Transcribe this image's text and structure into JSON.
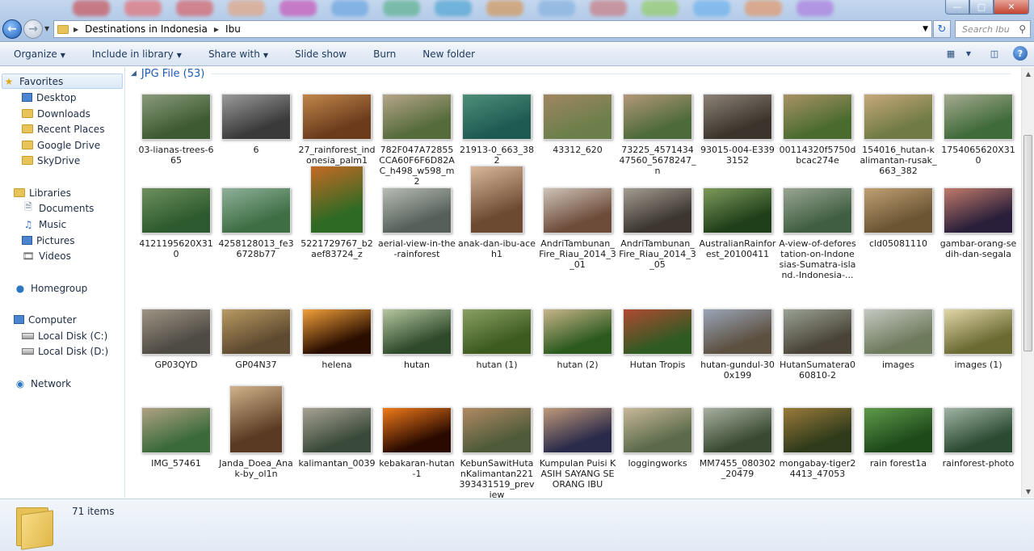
{
  "window": {
    "breadcrumb": [
      "Destinations in Indonesia",
      "Ibu"
    ],
    "search_placeholder": "Search Ibu",
    "controls": [
      "minimize",
      "maximize",
      "close"
    ]
  },
  "toolbar": {
    "organize": "Organize",
    "include_in_library": "Include in library",
    "share_with": "Share with",
    "slide_show": "Slide show",
    "burn": "Burn",
    "new_folder": "New folder"
  },
  "nav": {
    "favorites": {
      "label": "Favorites",
      "items": [
        "Desktop",
        "Downloads",
        "Recent Places",
        "Google Drive",
        "SkyDrive"
      ]
    },
    "libraries": {
      "label": "Libraries",
      "items": [
        "Documents",
        "Music",
        "Pictures",
        "Videos"
      ]
    },
    "homegroup": "Homegroup",
    "computer": {
      "label": "Computer",
      "items": [
        "Local Disk (C:)",
        "Local Disk (D:)"
      ]
    },
    "network": "Network"
  },
  "group": {
    "title": "JPG File (53)"
  },
  "files": [
    {
      "name": "03-lianas-trees-665",
      "shape": "land",
      "colors": [
        "#3d5a32",
        "#8a9a7a"
      ]
    },
    {
      "name": "6",
      "shape": "land",
      "colors": [
        "#3a3a3a",
        "#9a9a9a"
      ]
    },
    {
      "name": "27_rainforest_indonesia_palm1",
      "shape": "land",
      "colors": [
        "#6b3b1c",
        "#c0864a"
      ]
    },
    {
      "name": "782F047A72855CCA60F6F6D82AC_h498_w598_m2",
      "shape": "land",
      "colors": [
        "#556b3a",
        "#b5a58a"
      ]
    },
    {
      "name": "21913-0_663_382",
      "shape": "land",
      "colors": [
        "#1f5a52",
        "#4d8f7a"
      ]
    },
    {
      "name": "43312_620",
      "shape": "land",
      "colors": [
        "#6c7f4a",
        "#a08662"
      ]
    },
    {
      "name": "73225_457143447560_5678247_n",
      "shape": "land",
      "colors": [
        "#4d6a3a",
        "#b39878"
      ]
    },
    {
      "name": "93015-004-E3393152",
      "shape": "land",
      "colors": [
        "#3b342c",
        "#8c8277"
      ]
    },
    {
      "name": "00114320f5750dbcac274e",
      "shape": "land",
      "colors": [
        "#4a6b2e",
        "#a89266"
      ]
    },
    {
      "name": "154016_hutan-kalimantan-rusak_663_382",
      "shape": "land",
      "colors": [
        "#6f7a44",
        "#c6a87a"
      ]
    },
    {
      "name": "1754065620X310",
      "shape": "land",
      "colors": [
        "#3f6a3a",
        "#a5aa8f"
      ]
    },
    {
      "name": "4121195620X310",
      "shape": "land",
      "colors": [
        "#2d5a2e",
        "#6e8f5e"
      ]
    },
    {
      "name": "4258128013_fe36728b77",
      "shape": "land",
      "colors": [
        "#3e6f43",
        "#8fb09a"
      ]
    },
    {
      "name": "5221729767_b2aef83724_z",
      "shape": "port",
      "colors": [
        "#2f6a24",
        "#c46a24"
      ]
    },
    {
      "name": "aerial-view-in-the-rainforest",
      "shape": "land",
      "colors": [
        "#55605a",
        "#b8bcb5"
      ]
    },
    {
      "name": "anak-dan-ibu-aceh1",
      "shape": "port",
      "colors": [
        "#6c4a32",
        "#d8b79a"
      ]
    },
    {
      "name": "AndriTambunan_Fire_Riau_2014_3_01",
      "shape": "land",
      "colors": [
        "#6d4c3a",
        "#cfc3b8"
      ]
    },
    {
      "name": "AndriTambunan_Fire_Riau_2014_3_05",
      "shape": "land",
      "colors": [
        "#3c3530",
        "#a39d92"
      ]
    },
    {
      "name": "AustralianRainforest_20100411",
      "shape": "land",
      "colors": [
        "#1f3f1a",
        "#7d9a5a"
      ]
    },
    {
      "name": "A-view-of-deforestation-on-Indonesias-Sumatra-island.-Indonesia-...",
      "shape": "land",
      "colors": [
        "#3f5f42",
        "#9aa592"
      ]
    },
    {
      "name": "cld05081110",
      "shape": "land",
      "colors": [
        "#6a5533",
        "#c0a074"
      ]
    },
    {
      "name": "gambar-orang-sedih-dan-segala",
      "shape": "land",
      "colors": [
        "#2a1f3a",
        "#c07a6a"
      ]
    },
    {
      "name": "GP03QYD",
      "shape": "land",
      "colors": [
        "#4e4a44",
        "#9e9484"
      ]
    },
    {
      "name": "GP04N37",
      "shape": "land",
      "colors": [
        "#5e4a30",
        "#b89a62"
      ]
    },
    {
      "name": "helena",
      "shape": "land",
      "colors": [
        "#2a0e00",
        "#f2a03a"
      ]
    },
    {
      "name": "hutan",
      "shape": "land",
      "colors": [
        "#2f4a2a",
        "#b5c6a0"
      ]
    },
    {
      "name": "hutan (1)",
      "shape": "land",
      "colors": [
        "#3d5a1f",
        "#8aa064"
      ]
    },
    {
      "name": "hutan (2)",
      "shape": "land",
      "colors": [
        "#2c5a1e",
        "#c8b48a"
      ]
    },
    {
      "name": "Hutan Tropis",
      "shape": "land",
      "colors": [
        "#2f5a22",
        "#b04a32"
      ]
    },
    {
      "name": "hutan-gundul-300x199",
      "shape": "land",
      "colors": [
        "#5c5040",
        "#9aa5b8"
      ]
    },
    {
      "name": "HutanSumatera060810-2",
      "shape": "land",
      "colors": [
        "#4a4438",
        "#9aa294"
      ]
    },
    {
      "name": "images",
      "shape": "land",
      "colors": [
        "#6e7a5c",
        "#c5c9c2"
      ]
    },
    {
      "name": "images (1)",
      "shape": "land",
      "colors": [
        "#6a6a32",
        "#e2d6a8"
      ]
    },
    {
      "name": "IMG_57461",
      "shape": "land",
      "colors": [
        "#3a6a3a",
        "#b0a284"
      ]
    },
    {
      "name": "Janda_Doea_Anak-by_ol1n",
      "shape": "port",
      "colors": [
        "#5a3a22",
        "#d0b28a"
      ]
    },
    {
      "name": "kalimantan_0039",
      "shape": "land",
      "colors": [
        "#3a4a3a",
        "#a8a294"
      ]
    },
    {
      "name": "kebakaran-hutan-1",
      "shape": "land",
      "colors": [
        "#2a0a00",
        "#f07a1a"
      ]
    },
    {
      "name": "KebunSawitHutanKalimantan221393431519_preview",
      "shape": "land",
      "colors": [
        "#4e5a3a",
        "#b08a62"
      ]
    },
    {
      "name": "Kumpulan Puisi KASIH SAYANG SEORANG IBU",
      "shape": "land",
      "colors": [
        "#2a2a4a",
        "#c09a7a"
      ]
    },
    {
      "name": "loggingworks",
      "shape": "land",
      "colors": [
        "#5a6a4a",
        "#c8b89a"
      ]
    },
    {
      "name": "MM7455_080302_20479",
      "shape": "land",
      "colors": [
        "#3a4a32",
        "#a8b0a0"
      ]
    },
    {
      "name": "mongabay-tiger24413_47053",
      "shape": "land",
      "colors": [
        "#2e3a1a",
        "#9a7a3a"
      ]
    },
    {
      "name": "rain forest1a",
      "shape": "land",
      "colors": [
        "#1e4a1a",
        "#5e9a4a"
      ]
    },
    {
      "name": "rainforest-photo",
      "shape": "land",
      "colors": [
        "#2a4a32",
        "#a0b4a4"
      ]
    }
  ],
  "status": {
    "item_count": "71 items"
  }
}
